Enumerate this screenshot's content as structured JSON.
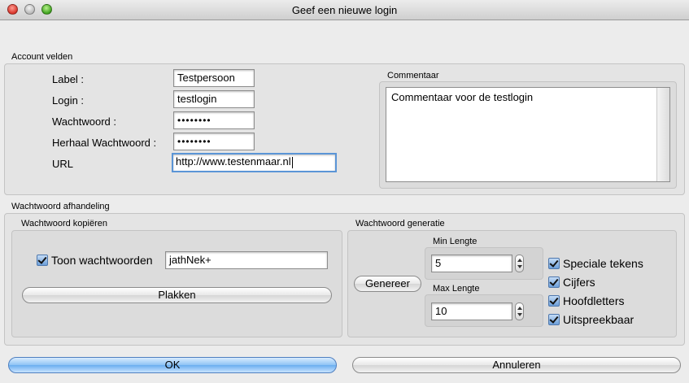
{
  "window": {
    "title": "Geef een nieuwe login"
  },
  "account": {
    "section_label": "Account velden",
    "label_label": "Label :",
    "label_value": "Testpersoon",
    "login_label": "Login :",
    "login_value": "testlogin",
    "password_label": "Wachtwoord :",
    "password_value": "••••••••",
    "repeat_password_label": "Herhaal Wachtwoord :",
    "repeat_password_value": "••••••••",
    "url_label": "URL",
    "url_value": "http://www.testenmaar.nl"
  },
  "comment": {
    "label": "Commentaar",
    "value": "Commentaar voor de testlogin"
  },
  "handling": {
    "section_label": "Wachtwoord afhandeling",
    "copy": {
      "label": "Wachtwoord kopiëren",
      "show_passwords_label": "Toon wachtwoorden",
      "show_passwords_checked": true,
      "password_value": "jathNek+",
      "paste_button": "Plakken"
    },
    "generation": {
      "label": "Wachtwoord generatie",
      "generate_button": "Genereer",
      "min_length_label": "Min Lengte",
      "min_length_value": "5",
      "max_length_label": "Max Lengte",
      "max_length_value": "10",
      "options": [
        {
          "label": "Speciale tekens",
          "checked": true
        },
        {
          "label": "Cijfers",
          "checked": true
        },
        {
          "label": "Hoofdletters",
          "checked": true
        },
        {
          "label": "Uitspreekbaar",
          "checked": true
        }
      ]
    }
  },
  "buttons": {
    "ok": "OK",
    "cancel": "Annuleren"
  },
  "colors": {
    "default_button": "#6aaef0",
    "focus_ring": "#5b95d6",
    "background": "#ececec"
  }
}
